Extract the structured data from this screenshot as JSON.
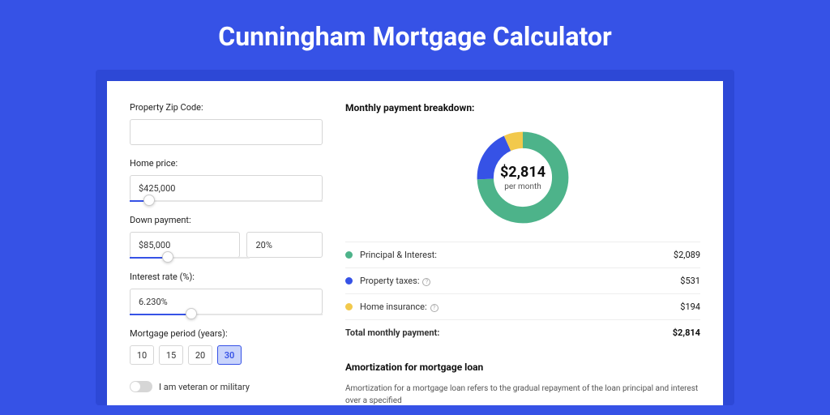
{
  "title": "Cunningham Mortgage Calculator",
  "form": {
    "zip_label": "Property Zip Code:",
    "zip_value": "",
    "price_label": "Home price:",
    "price_value": "$425,000",
    "down_label": "Down payment:",
    "down_value": "$85,000",
    "down_pct": "20%",
    "rate_label": "Interest rate (%):",
    "rate_value": "6.230%",
    "period_label": "Mortgage period (years):",
    "periods": [
      "10",
      "15",
      "20",
      "30"
    ],
    "period_active": "30",
    "vet_label": "I am veteran or military"
  },
  "breakdown": {
    "title": "Monthly payment breakdown:",
    "center_value": "$2,814",
    "center_sub": "per month",
    "rows": [
      {
        "label": "Principal & Interest:",
        "value": "$2,089",
        "color": "#4DB38A",
        "info": false
      },
      {
        "label": "Property taxes:",
        "value": "$531",
        "color": "#3652E6",
        "info": true
      },
      {
        "label": "Home insurance:",
        "value": "$194",
        "color": "#F2C94C",
        "info": true
      }
    ],
    "total_label": "Total monthly payment:",
    "total_value": "$2,814"
  },
  "amort": {
    "title": "Amortization for mortgage loan",
    "body": "Amortization for a mortgage loan refers to the gradual repayment of the loan principal and interest over a specified"
  },
  "chart_data": {
    "type": "pie",
    "title": "Monthly payment breakdown",
    "series": [
      {
        "name": "Principal & Interest",
        "value": 2089,
        "color": "#4DB38A"
      },
      {
        "name": "Property taxes",
        "value": 531,
        "color": "#3652E6"
      },
      {
        "name": "Home insurance",
        "value": 194,
        "color": "#F2C94C"
      }
    ],
    "total": 2814
  }
}
